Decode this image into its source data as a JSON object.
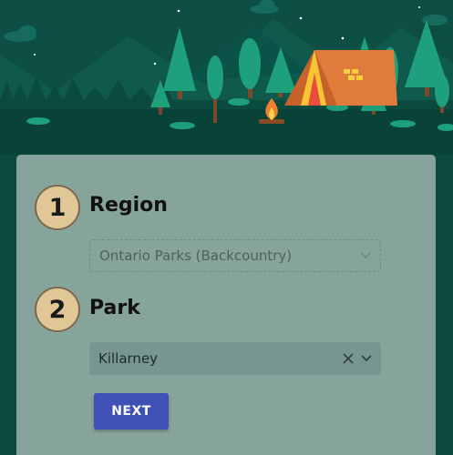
{
  "steps": [
    {
      "number": "1",
      "title": "Region"
    },
    {
      "number": "2",
      "title": "Park"
    }
  ],
  "region_select": {
    "value": "Ontario Parks (Backcountry)",
    "disabled": true
  },
  "park_select": {
    "value": "Killarney"
  },
  "next_button": {
    "label": "NEXT"
  },
  "colors": {
    "background": "#0b4a3e",
    "card": "#86a39c",
    "step_circle": "#e2c796",
    "button": "#3f51b5",
    "tent": "#e07b3c"
  }
}
